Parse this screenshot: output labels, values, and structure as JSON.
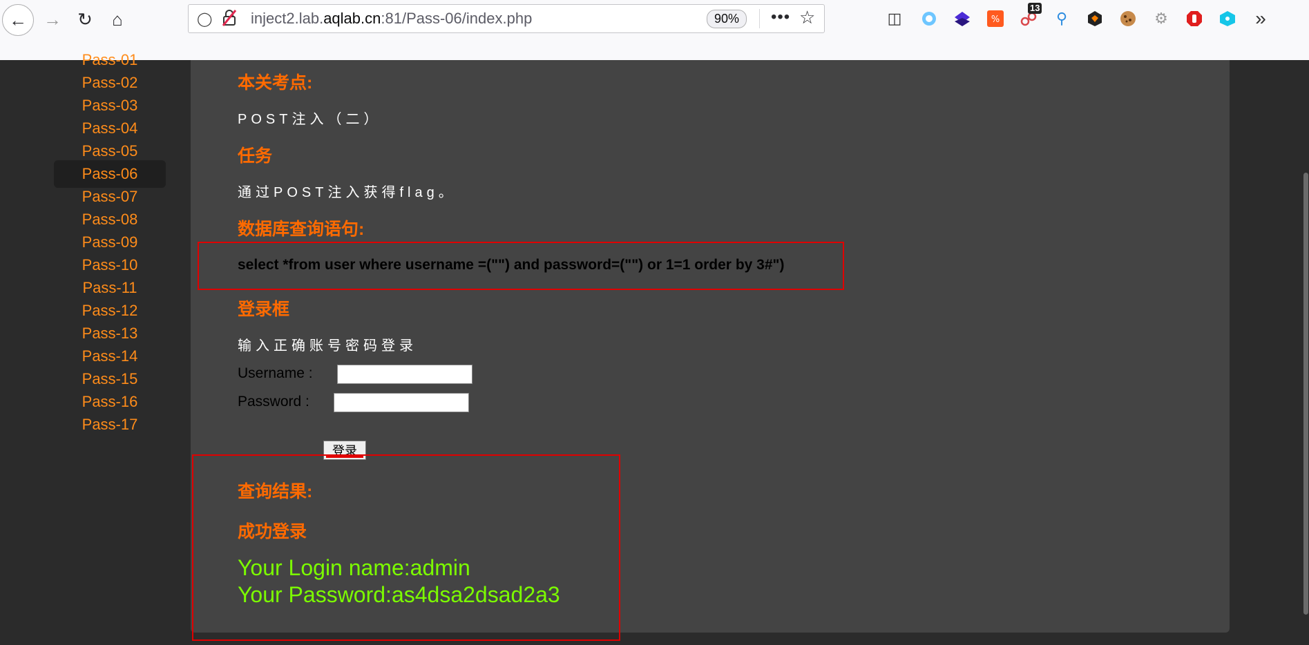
{
  "browser": {
    "url_host_prefix": "inject2.lab.",
    "url_host_domain": "aqlab.cn",
    "url_rest": ":81/Pass-06/index.php",
    "zoom": "90%",
    "more": "•••",
    "ext_badge": "13"
  },
  "sidebar": {
    "items": [
      "Pass-01",
      "Pass-02",
      "Pass-03",
      "Pass-04",
      "Pass-05",
      "Pass-06",
      "Pass-07",
      "Pass-08",
      "Pass-09",
      "Pass-10",
      "Pass-11",
      "Pass-12",
      "Pass-13",
      "Pass-14",
      "Pass-15",
      "Pass-16",
      "Pass-17"
    ],
    "active": "Pass-06"
  },
  "content": {
    "section_focus_title": "本关考点:",
    "section_focus_text": "POST注入（二）",
    "section_task_title": "任务",
    "section_task_text": "通过POST注入获得flag。",
    "section_sql_title": "数据库查询语句:",
    "sql_statement": "select *from user where username =(\"\") and password=(\"\") or 1=1 order by 3#\")",
    "section_login_title": "登录框",
    "login_hint": "输入正确账号密码登录",
    "username_label": "Username :",
    "password_label": "Password :",
    "login_button": "登录",
    "result_title": "查询结果:",
    "result_status": "成功登录",
    "result_login_name": "Your Login name:admin",
    "result_password": "Your Password:as4dsa2dsad2a3"
  },
  "colors": {
    "accent_orange": "#ff6a00",
    "link_orange": "#ff8c1a",
    "result_green": "#7cfc00",
    "highlight_red": "#e00000",
    "panel_bg": "#444444",
    "page_bg": "#2b2b2b"
  }
}
